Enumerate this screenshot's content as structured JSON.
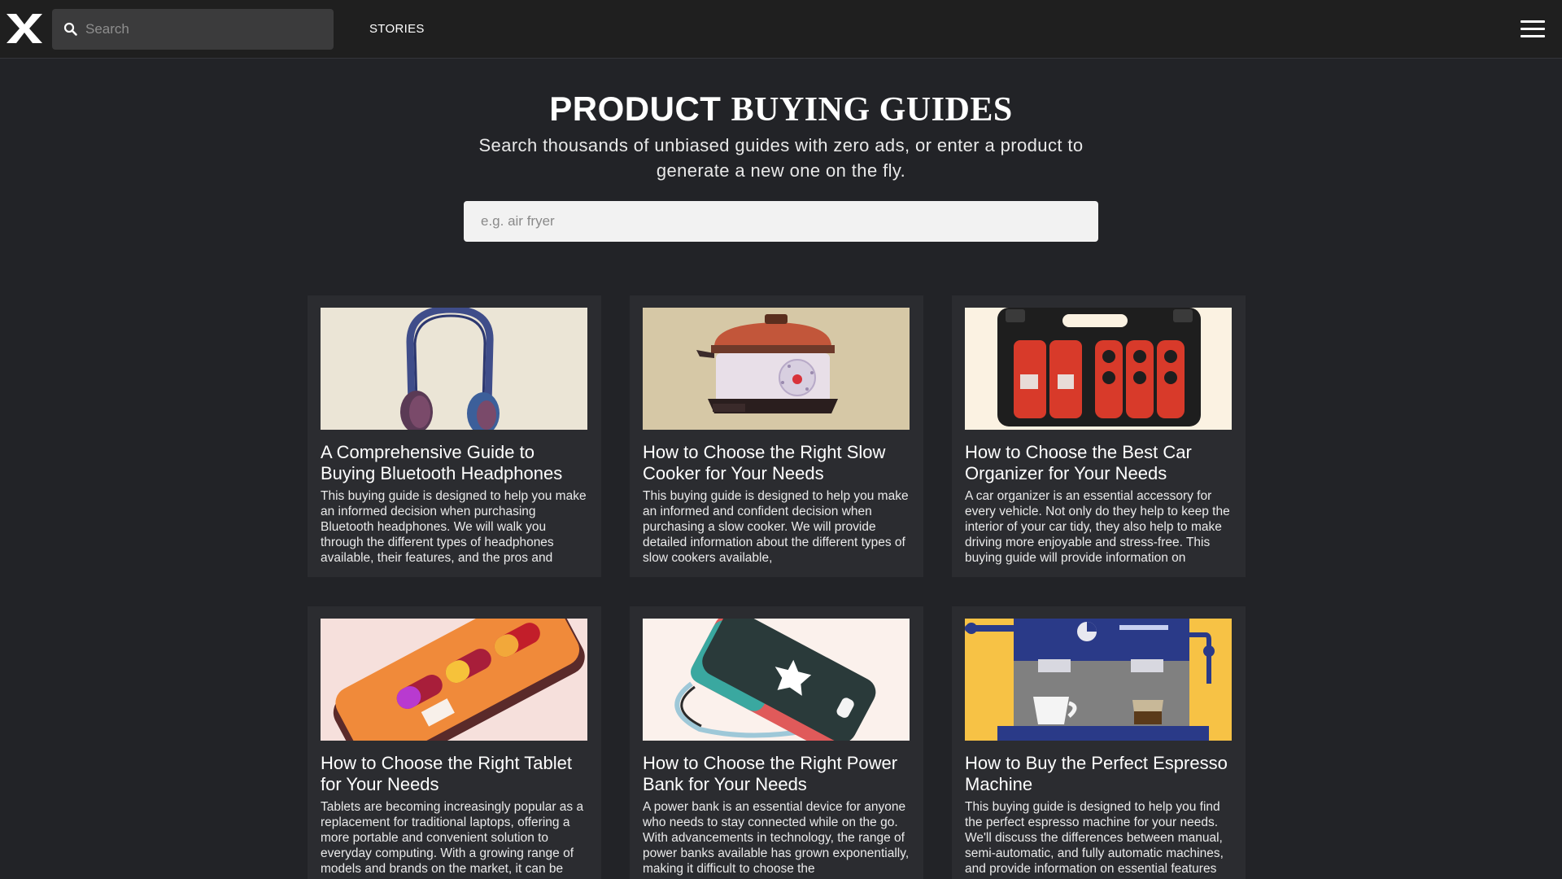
{
  "header": {
    "logo": "X",
    "search_placeholder": "Search",
    "nav_stories": "STORIES"
  },
  "hero": {
    "title_part1": "PRODUCT ",
    "title_part2": "BUYING GUIDES",
    "subtitle": "Search thousands of unbiased guides with zero ads, or enter a product to generate a new one on the fly.",
    "search_placeholder": "e.g. air fryer"
  },
  "cards": [
    {
      "image": "bluetooth-headphones-illustration",
      "title": "A Comprehensive Guide to Buying Bluetooth Headphones",
      "desc": "This buying guide is designed to help you make an informed decision when purchasing Bluetooth headphones. We will walk you through the different types of headphones available, their features, and the pros and"
    },
    {
      "image": "slow-cooker-illustration",
      "title": "How to Choose the Right Slow Cooker for Your Needs",
      "desc": "This buying guide is designed to help you make an informed and confident decision when purchasing a slow cooker. We will provide detailed information about the different types of slow cookers available,"
    },
    {
      "image": "car-organizer-illustration",
      "title": "How to Choose the Best Car Organizer for Your Needs",
      "desc": "A car organizer is an essential accessory for every vehicle. Not only do they help to keep the interior of your car tidy, they also help to make driving more enjoyable and stress-free. This buying guide will provide information on"
    },
    {
      "image": "tablet-illustration",
      "title": "How to Choose the Right Tablet for Your Needs",
      "desc": "Tablets are becoming increasingly popular as a replacement for traditional laptops, offering a more portable and convenient solution to everyday computing. With a growing range of models and brands on the market, it can be"
    },
    {
      "image": "power-bank-illustration",
      "title": "How to Choose the Right Power Bank for Your Needs",
      "desc": "A power bank is an essential device for anyone who needs to stay connected while on the go. With advancements in technology, the range of power banks available has grown exponentially, making it difficult to choose the"
    },
    {
      "image": "espresso-machine-illustration",
      "title": "How to Buy the Perfect Espresso Machine",
      "desc": "This buying guide is designed to help you find the perfect espresso machine for your needs. We'll discuss the differences between manual, semi-automatic, and fully automatic machines, and provide information on essential features"
    }
  ],
  "colors": {
    "background": "#222327",
    "topbar": "#1f1f1f",
    "card": "#2b2c30",
    "search_field": "#3b3b3c"
  }
}
